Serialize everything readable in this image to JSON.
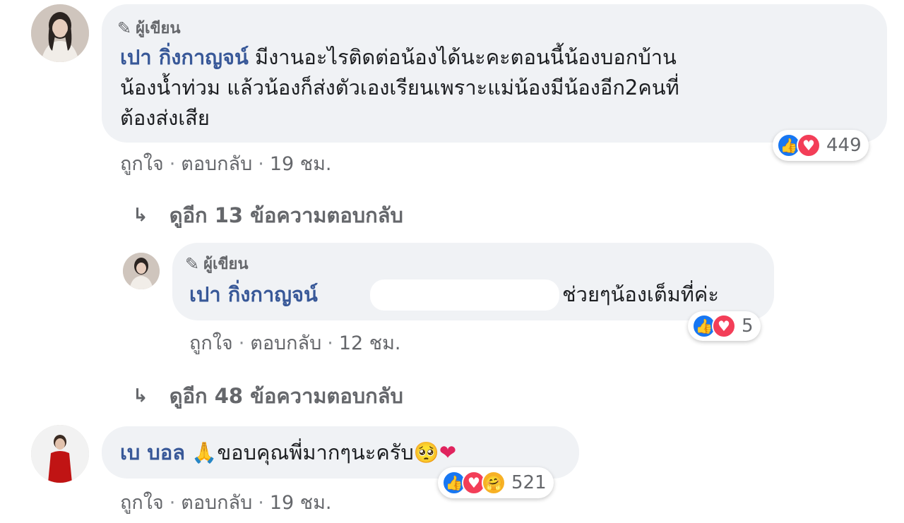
{
  "comments": [
    {
      "author_tag": "ผู้เขียน",
      "name": "เปา กิ่งกาญจน์",
      "lines": [
        " มีงานอะไรติดต่อน้องได้นะคะตอนนี้น้องบอกบ้าน",
        "น้องน้ำท่วม แล้วน้องก็ส่งตัวเองเรียนเพราะแม่น้องมีน้องอีก2คนที่",
        "ต้องส่งเสีย"
      ],
      "reaction_count": "449",
      "actions": {
        "like": "ถูกใจ",
        "reply": "ตอบกลับ",
        "time": "19 ชม."
      }
    },
    {
      "author_tag": "ผู้เขียน",
      "name": "เปา กิ่งกาญจน์",
      "text": "ช่วยๆน้องเต็มที่ค่ะ",
      "reaction_count": "5",
      "actions": {
        "like": "ถูกใจ",
        "reply": "ตอบกลับ",
        "time": "12 ชม."
      }
    },
    {
      "name": "เบ บอล",
      "text": "ขอบคุณพี่มากๆนะครับ",
      "reaction_count": "521",
      "actions": {
        "like": "ถูกใจ",
        "reply": "ตอบกลับ",
        "time": "19 ชม."
      }
    }
  ],
  "more_replies": [
    "ดูอีก 13 ข้อความตอบกลับ",
    "ดูอีก 48 ข้อความตอบกลับ"
  ],
  "icons": {
    "pen": "✎",
    "arrow": "↳",
    "like": "👍",
    "love": "♥",
    "care": "🤗",
    "pray": "🙏",
    "pleading": "🥺",
    "heart": "❤"
  },
  "colors": {
    "bubble": "#f0f2f5",
    "name": "#385898",
    "meta": "#65676b",
    "like": "#1877f2",
    "love": "#f33e58"
  }
}
